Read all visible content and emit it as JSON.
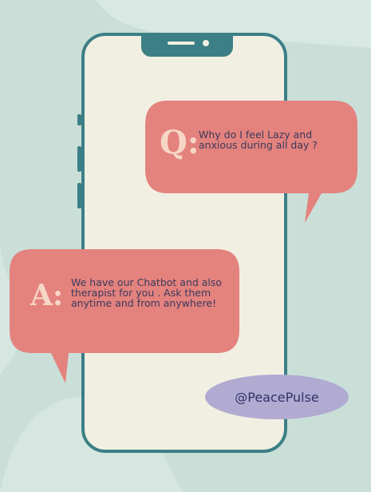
{
  "question": {
    "prefix": "Q:",
    "text": "Why do I feel Lazy and anxious during all day ?"
  },
  "answer": {
    "prefix": "A:",
    "text": "We have our Chatbot and also therapist for you . Ask them anytime and from anywhere!"
  },
  "handle": "@PeacePulse",
  "colors": {
    "background": "#c9dfd8",
    "phone_frame": "#3c7f86",
    "phone_screen": "#f1efe2",
    "bubble": "#e4827e",
    "letter": "#f6d7c6",
    "handle_pill": "#b1aad1"
  }
}
